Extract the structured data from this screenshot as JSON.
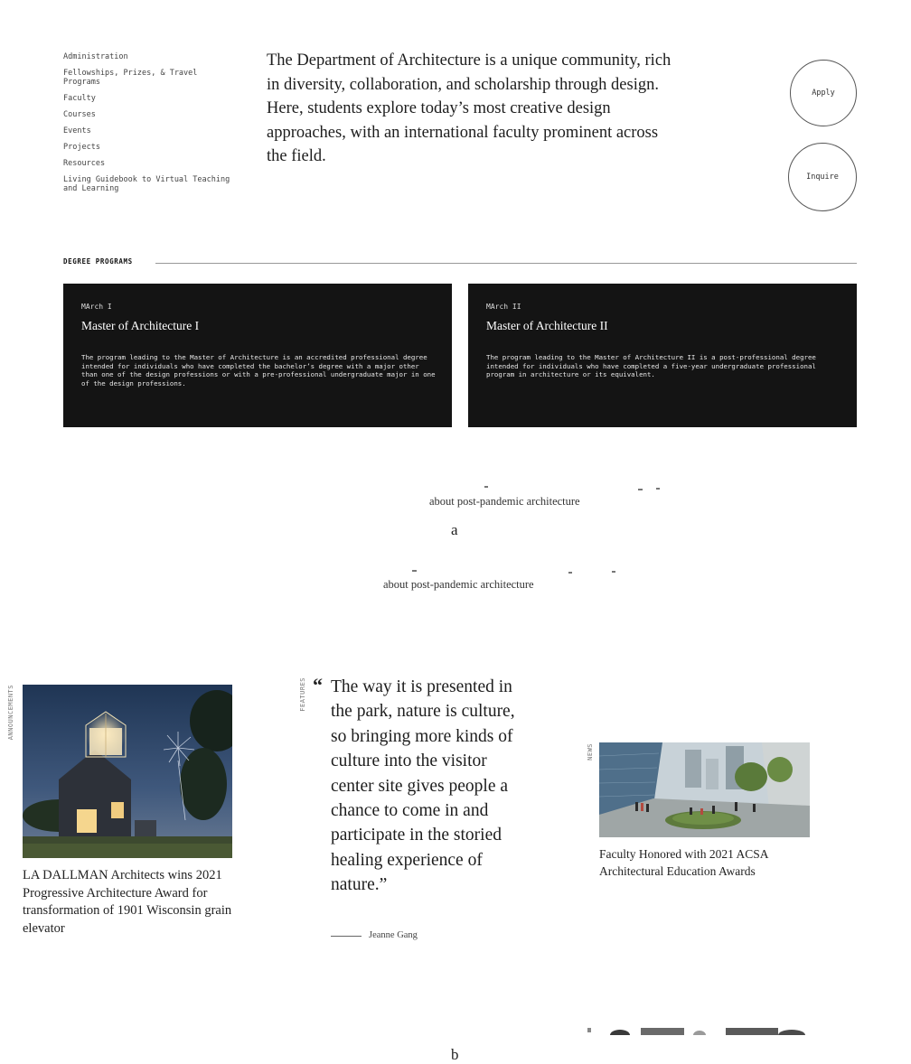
{
  "panel_a": {
    "nav": [
      "Administration",
      "Fellowships, Prizes, & Travel Programs",
      "Faculty",
      "Courses",
      "Events",
      "Projects",
      "Resources",
      "Living Guidebook to Virtual Teaching and Learning"
    ],
    "intro": "The Department of Architecture is a unique community, rich in diversity, collaboration, and scholarship through design. Here, students explore today’s most creative design approaches, with an international faculty prominent across the field.",
    "buttons": {
      "apply": "Apply",
      "inquire": "Inquire"
    },
    "degree_programs": {
      "heading": "DEGREE PROGRAMS",
      "cards": [
        {
          "code": "MArch I",
          "title": "Master of Architecture I",
          "description": "The program leading to the Master of Architecture is an accredited professional degree intended for individuals who have completed the bachelor’s degree with a major other than one of the design professions or with a pre-professional undergraduate major in one of the design professions."
        },
        {
          "code": "MArch II",
          "title": "Master of Architecture II",
          "description": "The program leading to the Master of Architecture II is a post-professional degree intended for individuals who have completed a five-year undergraduate professional program in architecture or its equivalent."
        }
      ]
    },
    "caption_snippet": "about post-pandemic architecture",
    "label": "a"
  },
  "panel_b": {
    "caption_snippet": "about post-pandemic architecture",
    "announcements": {
      "label": "ANNOUNCEMENTS",
      "title": "LA DALLMAN Architects wins 2021 Progressive Architecture Award for transformation of 1901 Wisconsin grain elevator"
    },
    "features": {
      "label": "FEATURES",
      "quote_mark": "“",
      "quote": "The way it is presented in the park, nature is culture, so bringing more kinds of culture into the visitor center site gives people a chance to come in and participate in the storied healing experience of nature.”",
      "author": "Jeanne Gang"
    },
    "news": {
      "label": "NEWS",
      "title": "Faculty Honored with 2021 ACSA Architectural Education Awards"
    },
    "label": "b"
  }
}
